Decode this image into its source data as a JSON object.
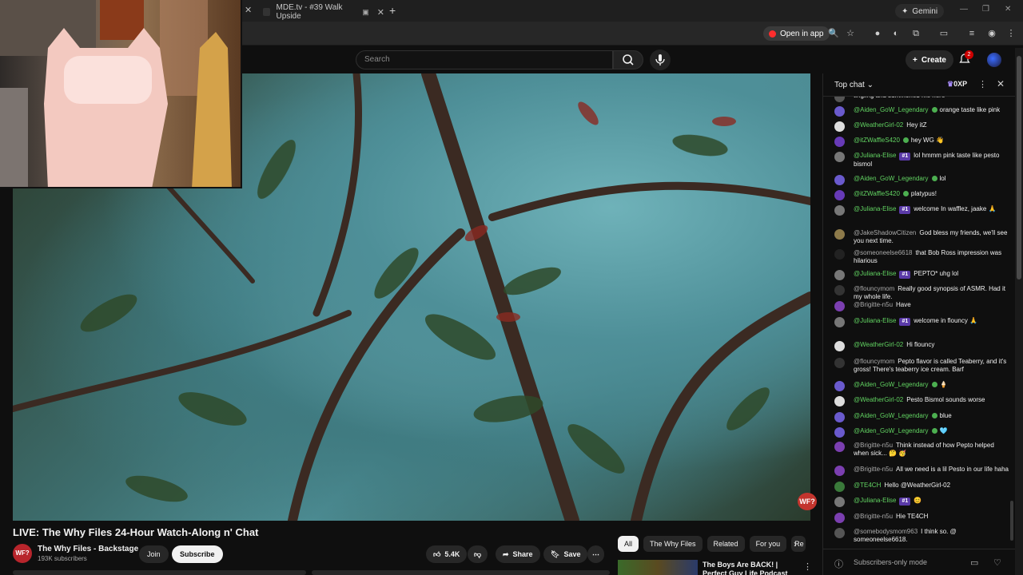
{
  "browser": {
    "active_tab_title": "MDE.tv - #39 Walk Upside",
    "gemini_label": "Gemini",
    "open_in_app_label": "Open in app"
  },
  "header": {
    "search_placeholder": "Search",
    "create_label": "Create",
    "notification_count": "2"
  },
  "video": {
    "title": "LIVE: The Why Files 24-Hour Watch-Along n' Chat",
    "logo_text": "WF?"
  },
  "channel": {
    "avatar_text": "WF?",
    "name": "The Why Files - Backstage",
    "subscribers": "193K subscribers",
    "join_label": "Join",
    "subscribe_label": "Subscribe"
  },
  "actions": {
    "likes": "5.4K",
    "share_label": "Share",
    "save_label": "Save"
  },
  "chips": [
    "All",
    "The Why Files",
    "Related",
    "For you",
    "Re"
  ],
  "recommended": {
    "title": "The Boys Are BACK! | Perfect Guy Life Podcast #116 w/ Sa"
  },
  "chat": {
    "title": "Top chat",
    "xp": "0XP",
    "footer": "Subscribers-only mode",
    "messages": [
      {
        "author": "",
        "text": "tingling and summoned me here",
        "av": "#555"
      },
      {
        "author": "@Aiden_GoW_Legendary",
        "green": true,
        "heart": true,
        "text": "orange taste like pink",
        "av": "#6a5acd"
      },
      {
        "author": "@WeatherGirl-02",
        "green": true,
        "text": "Hey itZ",
        "av": "#ddd"
      },
      {
        "author": "@itZWaffleS420",
        "green": true,
        "heart": true,
        "text": "hey WG 👋",
        "av": "#673ab7"
      },
      {
        "author": "@Juliana-Elise",
        "green": true,
        "tag": "#1",
        "text": "lol hmmm pink taste like pesto bismol",
        "av": "#777"
      },
      {
        "author": "@Aiden_GoW_Legendary",
        "green": true,
        "heart": true,
        "text": "lol",
        "av": "#6a5acd"
      },
      {
        "author": "@itZWaffleS420",
        "green": true,
        "heart": true,
        "text": "platypus!",
        "av": "#673ab7"
      },
      {
        "author": "@Juliana-Elise",
        "green": true,
        "tag": "#1",
        "text": "welcome In wafflez, jaake 🙏",
        "av": "#777"
      },
      {
        "author": "@JakeShadowCitizen",
        "text": "God bless my friends, we'll see you next time.",
        "av": "#8d7a4a"
      },
      {
        "author": "@someoneelse6618",
        "text": "that Bob Ross impression was hilarious",
        "av": "#222"
      },
      {
        "author": "@Juliana-Elise",
        "green": true,
        "tag": "#1",
        "text": "PEPTO* uhg lol",
        "av": "#777"
      },
      {
        "author": "@flouncymom",
        "text": "Really good synopsis of ASMR. Had it my whole life.",
        "av": "#333"
      },
      {
        "author": "@Brigitte-n5u",
        "text": "Have",
        "av": "#7b3fb0"
      },
      {
        "author": "@Juliana-Elise",
        "green": true,
        "tag": "#1",
        "text": "welcome in flouncy 🙏",
        "av": "#777"
      },
      {
        "author": "@WeatherGirl-02",
        "green": true,
        "text": "Hi flouncy",
        "av": "#ddd"
      },
      {
        "author": "@flouncymom",
        "text": "Pepto flavor is called Teaberry, and it's gross! There's teaberry ice cream. Barf",
        "av": "#333"
      },
      {
        "author": "@Aiden_GoW_Legendary",
        "green": true,
        "heart": true,
        "text": "🍦",
        "av": "#6a5acd"
      },
      {
        "author": "@WeatherGirl-02",
        "green": true,
        "text": "Pesto Bismol sounds worse",
        "av": "#ddd"
      },
      {
        "author": "@Aiden_GoW_Legendary",
        "green": true,
        "heart": true,
        "text": "blue",
        "av": "#6a5acd"
      },
      {
        "author": "@Aiden_GoW_Legendary",
        "green": true,
        "heart": true,
        "text": "🩵",
        "av": "#6a5acd"
      },
      {
        "author": "@Brigitte-n5u",
        "text": "Think instead of how Pepto helped when sick... 🤔 🥳",
        "av": "#7b3fb0"
      },
      {
        "author": "@Brigitte-n5u",
        "text": "All we need is a lil Pesto in our life haha",
        "av": "#7b3fb0"
      },
      {
        "author": "@TE4CH",
        "green": true,
        "text": "Hello @WeatherGirl-02",
        "av": "#3a7a3a"
      },
      {
        "author": "@Juliana-Elise",
        "green": true,
        "tag": "#1",
        "text": "😊",
        "av": "#777"
      },
      {
        "author": "@Brigitte-n5u",
        "text": "Hie TE4CH",
        "av": "#7b3fb0"
      },
      {
        "author": "@somebodysmom963",
        "text": "I think so. @ someoneelse6618.",
        "av": "#555"
      }
    ]
  }
}
